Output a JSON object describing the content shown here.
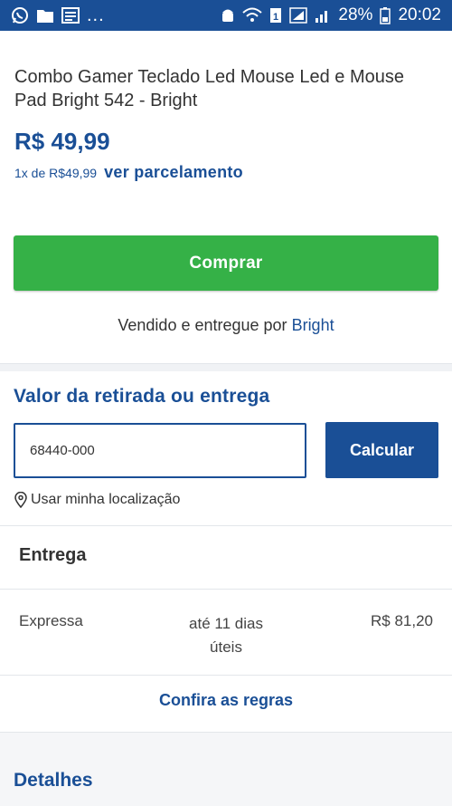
{
  "status_bar": {
    "dots": "...",
    "battery_percent": "28%",
    "time": "20:02",
    "background": "#1a4f96"
  },
  "product": {
    "title": "Combo Gamer Teclado Led Mouse Led e Mouse Pad Bright 542 - Bright",
    "price": "R$ 49,99",
    "installment_text": "1x de R$49,99",
    "installment_link": "ver parcelamento"
  },
  "buy": {
    "label": "Comprar",
    "color": "#35b147"
  },
  "seller": {
    "prefix": "Vendido e entregue por",
    "name": "Bright"
  },
  "shipping": {
    "title": "Valor da retirada ou entrega",
    "cep_value": "68440-000",
    "calculate_label": "Calcular",
    "location_label": "Usar minha localização",
    "delivery_title": "Entrega",
    "options": [
      {
        "type": "Expressa",
        "days_line1": "até 11 dias",
        "days_line2": "úteis",
        "price": "R$ 81,20"
      }
    ],
    "rules_link": "Confira as regras"
  },
  "details": {
    "title": "Detalhes"
  },
  "colors": {
    "brand_blue": "#1a4f96",
    "buy_green": "#35b147"
  }
}
